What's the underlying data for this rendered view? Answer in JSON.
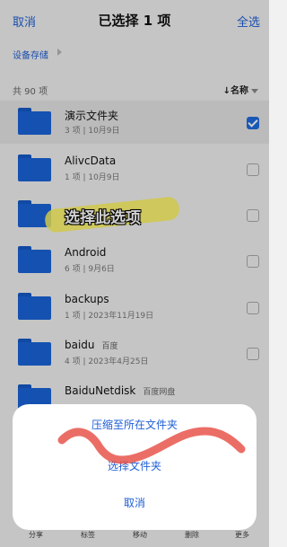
{
  "header": {
    "cancel_label": "取消",
    "title": "已选择 1 项",
    "select_all_label": "全选"
  },
  "breadcrumb": {
    "label": "设备存储"
  },
  "list_header": {
    "count_label": "共 90 项",
    "sort_label": "↓名称"
  },
  "files": [
    {
      "name": "演示文件夹",
      "tag": "",
      "meta": "3 项 | 10月9日",
      "selected": true
    },
    {
      "name": "AlivcData",
      "tag": "",
      "meta": "1 项 | 10月9日",
      "selected": false
    },
    {
      "name": "",
      "tag": "",
      "meta": "",
      "selected": false
    },
    {
      "name": "Android",
      "tag": "",
      "meta": "6 项 | 9月6日",
      "selected": false
    },
    {
      "name": "backups",
      "tag": "",
      "meta": "1 项 | 2023年11月19日",
      "selected": false
    },
    {
      "name": "baidu",
      "tag": "百度",
      "meta": "4 项 | 2023年4月25日",
      "selected": false
    },
    {
      "name": "BaiduNetdisk",
      "tag": "百度网盘",
      "meta": "",
      "selected": false
    }
  ],
  "annotation": {
    "text": "选择此选项"
  },
  "action_sheet": {
    "compress_label": "压缩至所在文件夹",
    "select_folder_label": "选择文件夹",
    "cancel_label": "取消"
  },
  "bottom_nav": {
    "share": "分享",
    "tag": "标签",
    "move": "移动",
    "delete": "删除",
    "more": "更多"
  },
  "colors": {
    "accent": "#1f5fd6",
    "folder": "#1a63d8",
    "highlight": "#fff45a",
    "scribble": "#e8554b"
  }
}
